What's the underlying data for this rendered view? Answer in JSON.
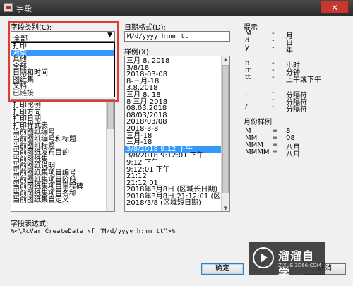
{
  "window": {
    "title": "字段",
    "close": "✕"
  },
  "category": {
    "label": "字段类别(C):",
    "selected": "全部",
    "options": [
      "打印",
      "对象",
      "其他",
      "全部",
      "日期和时间",
      "图纸集",
      "文档",
      "已链接"
    ],
    "highlighted_index": 1
  },
  "field_names": {
    "rows": [
      "打印比例",
      "打印方向",
      "打印日期",
      "打印样式表",
      "当前图纸编号",
      "当前图纸编号和标题",
      "当前图纸标题",
      "当前图纸发布目的",
      "当前图纸集",
      "当前图纸说明",
      "当前图纸集项目编号",
      "当前图纸集项目阶段",
      "当前图纸集项目里程碑",
      "当前图纸集项目名称",
      "当前图纸集自定义"
    ]
  },
  "date_format": {
    "label": "日期格式(D):",
    "value": "M/d/yyyy h:mm tt"
  },
  "examples": {
    "label": "样例(X):",
    "rows": [
      "三月 8, 2018",
      "3/8/18",
      "2018-03-08",
      "8-三月-18",
      "3.8.2018",
      "三月 8, 18",
      "8 三月 2018",
      "08.03.2018",
      "08/03/2018",
      "2018/03/08",
      "2018-3-8",
      "三月-18",
      "三月-18",
      "3/8/2018 9:12 下午",
      "3/8/2018 9:12:01 下午",
      "9:12 下午",
      "9:12:01 下午",
      "21:12",
      "21:12:01",
      "2018年3月8日 (区域长日期)",
      "2018年3月8日 21:12:01 (区域",
      "2018/3/8 (区域短日期)"
    ],
    "selected_index": 13
  },
  "hints": {
    "label": "提示",
    "rows": [
      {
        "code": "M",
        "dash": "-",
        "desc": "月"
      },
      {
        "code": "d",
        "dash": "-",
        "desc": "日"
      },
      {
        "code": "y",
        "dash": "-",
        "desc": "年"
      },
      {
        "code": "h",
        "dash": "-",
        "desc": "小时"
      },
      {
        "code": "m",
        "dash": "-",
        "desc": "分钟"
      },
      {
        "code": "tt",
        "dash": "-",
        "desc": "上午或下午"
      },
      {
        "code": ",",
        "dash": "-",
        "desc": "分隔符"
      },
      {
        "code": ".",
        "dash": "-",
        "desc": "分隔符"
      },
      {
        "code": "/",
        "dash": "-",
        "desc": "分隔符"
      }
    ]
  },
  "month_examples": {
    "label": "月份样例:",
    "rows": [
      {
        "code": "M",
        "dash": "=",
        "desc": "8"
      },
      {
        "code": "MM",
        "dash": "=",
        "desc": "08"
      },
      {
        "code": "MMM",
        "dash": "=",
        "desc": "八月"
      },
      {
        "code": "MMMM",
        "dash": "=",
        "desc": "八月"
      }
    ]
  },
  "expression": {
    "label": "字段表达式:",
    "value": "%<\\AcVar CreateDate \\f \"M/d/yyyy h:mm tt\">%"
  },
  "buttons": {
    "ok": "确定",
    "cancel": "取消"
  },
  "watermark": {
    "main": "溜溜自学",
    "sub": "ZIXUE.3D66.COM"
  }
}
